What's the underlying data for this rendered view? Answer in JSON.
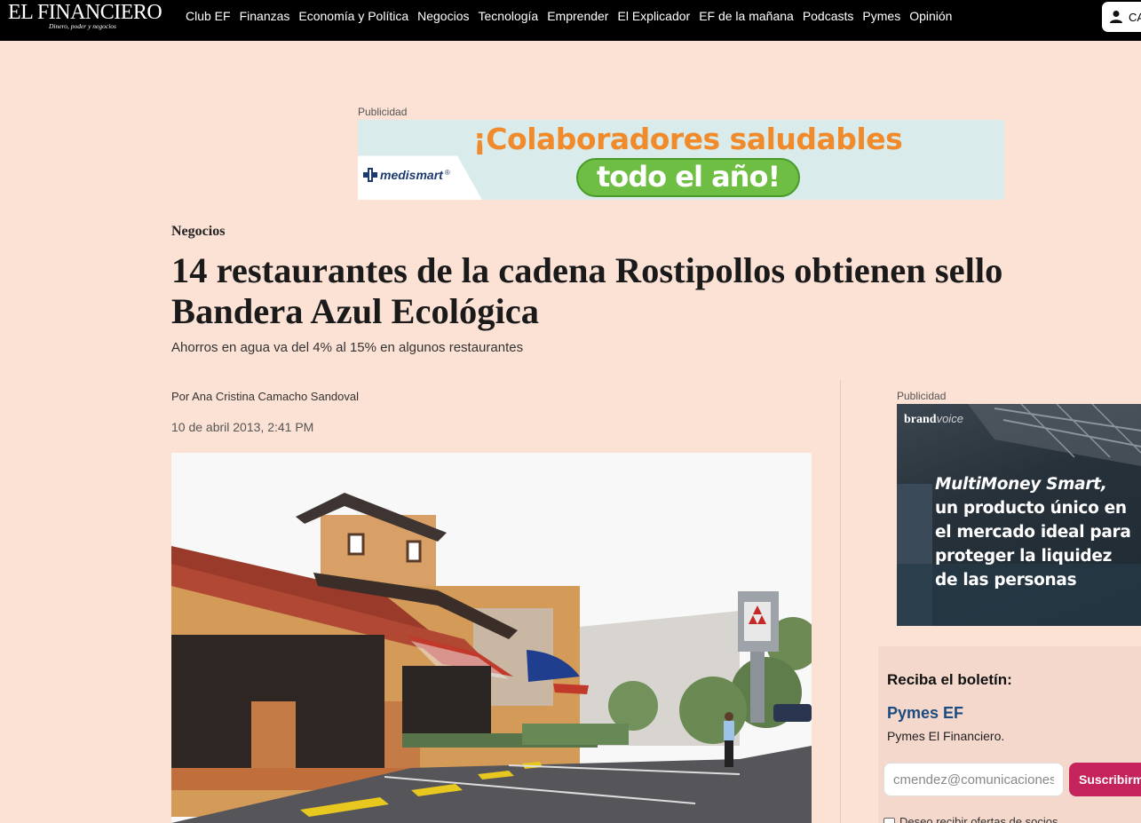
{
  "header": {
    "logo_title": "EL FINANCIERO",
    "logo_tagline": "Dinero, poder y negocios",
    "nav": [
      "Club EF",
      "Finanzas",
      "Economía y Política",
      "Negocios",
      "Tecnología",
      "Emprender",
      "El Explicador",
      "EF de la mañana",
      "Podcasts",
      "Pymes",
      "Opinión"
    ],
    "account_label": "CA"
  },
  "top_ad": {
    "label": "Publicidad",
    "brand": "medismart",
    "headline": "¡Colaboradores saludables",
    "pill": "todo el año!",
    "headline_color": "#f08a2a",
    "pill_color": "#6fbe44"
  },
  "article": {
    "section": "Negocios",
    "title": "14 restaurantes de la cadena Rostipollos obtienen sello Bandera Azul Ecológica",
    "subtitle": "Ahorros en agua va del 4% al 15% en algunos restaurantes",
    "byline": "Por Ana Cristina Camacho Sandoval",
    "date": "10 de abril 2013, 2:41 PM"
  },
  "sidebar": {
    "ad_label": "Publicidad",
    "brandvoice_bold": "brand",
    "brandvoice_light": "voice",
    "brandvoice_emphasis": "MultiMoney Smart,",
    "brandvoice_text": " un producto único en el mercado ideal para proteger la liquidez de las personas",
    "newsletter": {
      "title": "Reciba el boletín:",
      "name": "Pymes EF",
      "description": "Pymes El Financiero.",
      "email_value": "cmendez@comunicacionesestrategicas.com",
      "button": "Suscribirme",
      "checkbox_label": "Deseo recibir ofertas de socios",
      "name_color": "#1c4b80",
      "button_color": "#c4235b"
    }
  }
}
